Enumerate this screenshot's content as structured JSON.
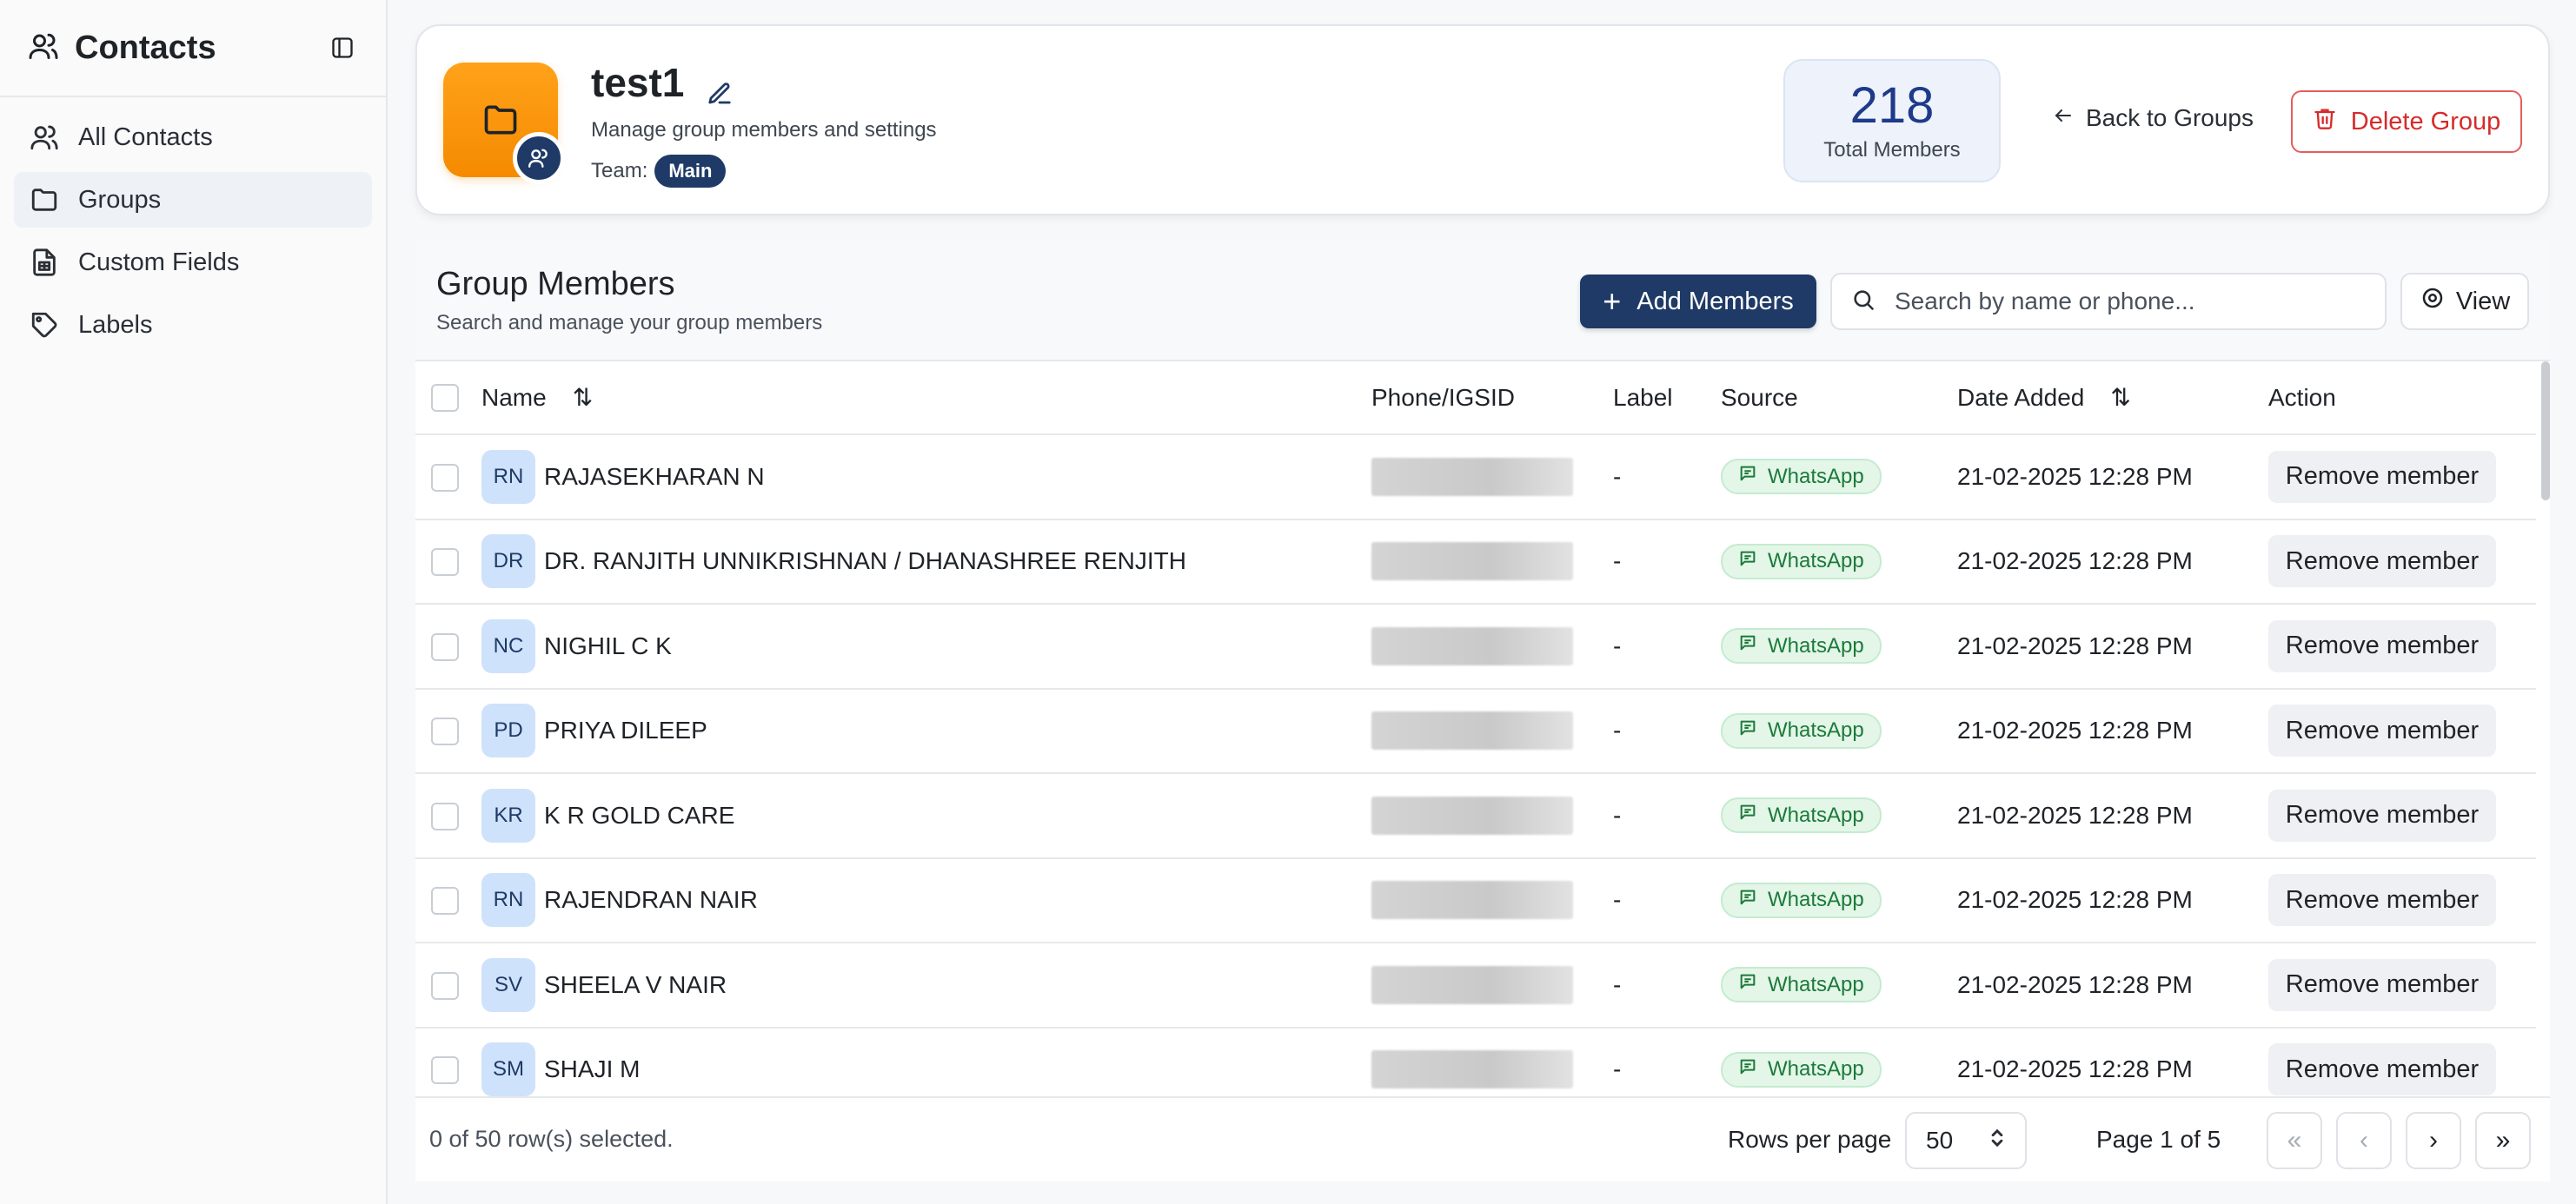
{
  "sidebar": {
    "title": "Contacts",
    "items": [
      {
        "label": "All Contacts",
        "icon": "users-icon",
        "active": false
      },
      {
        "label": "Groups",
        "icon": "folder-icon",
        "active": true
      },
      {
        "label": "Custom Fields",
        "icon": "file-icon",
        "active": false
      },
      {
        "label": "Labels",
        "icon": "tag-icon",
        "active": false
      }
    ]
  },
  "group": {
    "name": "test1",
    "subtitle": "Manage group members and settings",
    "team_label": "Team:",
    "team": "Main",
    "total_members": "218",
    "total_label": "Total Members",
    "back_label": "Back to Groups",
    "delete_label": "Delete Group"
  },
  "members": {
    "title": "Group Members",
    "subtitle": "Search and manage your group members",
    "add_label": "Add Members",
    "search_placeholder": "Search by name or phone...",
    "view_label": "View",
    "columns": {
      "name": "Name",
      "phone": "Phone/IGSID",
      "label": "Label",
      "source": "Source",
      "date": "Date Added",
      "action": "Action"
    },
    "rows": [
      {
        "initials": "RN",
        "name": "RAJASEKHARAN N",
        "label": "-",
        "source": "WhatsApp",
        "date": "21-02-2025 12:28 PM",
        "action": "Remove member"
      },
      {
        "initials": "DR",
        "name": "DR. RANJITH UNNIKRISHNAN / DHANASHREE RENJITH",
        "label": "-",
        "source": "WhatsApp",
        "date": "21-02-2025 12:28 PM",
        "action": "Remove member"
      },
      {
        "initials": "NC",
        "name": "NIGHIL C K",
        "label": "-",
        "source": "WhatsApp",
        "date": "21-02-2025 12:28 PM",
        "action": "Remove member"
      },
      {
        "initials": "PD",
        "name": "PRIYA DILEEP",
        "label": "-",
        "source": "WhatsApp",
        "date": "21-02-2025 12:28 PM",
        "action": "Remove member"
      },
      {
        "initials": "KR",
        "name": "K R GOLD CARE",
        "label": "-",
        "source": "WhatsApp",
        "date": "21-02-2025 12:28 PM",
        "action": "Remove member"
      },
      {
        "initials": "RN",
        "name": "RAJENDRAN NAIR",
        "label": "-",
        "source": "WhatsApp",
        "date": "21-02-2025 12:28 PM",
        "action": "Remove member"
      },
      {
        "initials": "SV",
        "name": "SHEELA V NAIR",
        "label": "-",
        "source": "WhatsApp",
        "date": "21-02-2025 12:28 PM",
        "action": "Remove member"
      },
      {
        "initials": "SM",
        "name": "SHAJI M",
        "label": "-",
        "source": "WhatsApp",
        "date": "21-02-2025 12:28 PM",
        "action": "Remove member"
      }
    ]
  },
  "footer": {
    "selected_text": "0 of 50 row(s) selected.",
    "rows_per_page_label": "Rows per page",
    "rows_per_page": "50",
    "page_text": "Page 1 of 5",
    "first": "«",
    "prev": "‹",
    "next": "›",
    "last": "»"
  },
  "colors": {
    "primary": "#1f3a66",
    "danger": "#d62b2b",
    "folder": "#f58a00",
    "whatsapp_bg": "#e3f6e8",
    "whatsapp_text": "#1c7a3a"
  }
}
